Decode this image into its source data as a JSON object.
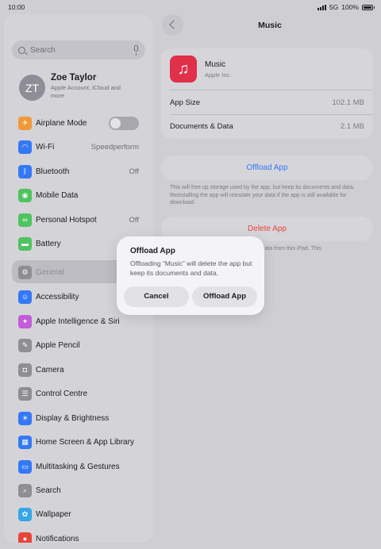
{
  "status": {
    "time": "10:00",
    "network": "5G",
    "battery": "100%"
  },
  "sidebar": {
    "search_placeholder": "Search",
    "profile": {
      "initials": "ZT",
      "name": "Zoe Taylor",
      "sub": "Apple Account, iCloud and more"
    },
    "items": [
      {
        "label": "Airplane Mode",
        "icon": "airplane-icon",
        "color": "#f09a37",
        "value": ""
      },
      {
        "label": "Wi-Fi",
        "icon": "wifi-icon",
        "color": "#3478f6",
        "value": "Speedperform"
      },
      {
        "label": "Bluetooth",
        "icon": "bluetooth-icon",
        "color": "#3478f6",
        "value": "Off"
      },
      {
        "label": "Mobile Data",
        "icon": "antenna-icon",
        "color": "#4fc35f",
        "value": ""
      },
      {
        "label": "Personal Hotspot",
        "icon": "hotspot-icon",
        "color": "#4fc35f",
        "value": "Off"
      },
      {
        "label": "Battery",
        "icon": "battery-icon",
        "color": "#4fc35f",
        "value": ""
      },
      {
        "label": "General",
        "icon": "gear-icon",
        "color": "#8e8e93",
        "value": ""
      },
      {
        "label": "Accessibility",
        "icon": "accessibility-icon",
        "color": "#3478f6",
        "value": ""
      },
      {
        "label": "Apple Intelligence & Siri",
        "icon": "siri-icon",
        "color": "#c25cd9",
        "value": ""
      },
      {
        "label": "Apple Pencil",
        "icon": "pencil-icon",
        "color": "#8e8e93",
        "value": ""
      },
      {
        "label": "Camera",
        "icon": "camera-icon",
        "color": "#8e8e93",
        "value": ""
      },
      {
        "label": "Control Centre",
        "icon": "sliders-icon",
        "color": "#8e8e93",
        "value": ""
      },
      {
        "label": "Display & Brightness",
        "icon": "sun-icon",
        "color": "#3478f6",
        "value": ""
      },
      {
        "label": "Home Screen & App Library",
        "icon": "home-screen-icon",
        "color": "#3478f6",
        "value": ""
      },
      {
        "label": "Multitasking & Gestures",
        "icon": "multitasking-icon",
        "color": "#3478f6",
        "value": ""
      },
      {
        "label": "Search",
        "icon": "search-icon",
        "color": "#8e8e93",
        "value": ""
      },
      {
        "label": "Wallpaper",
        "icon": "wallpaper-icon",
        "color": "#35a6e8",
        "value": ""
      },
      {
        "label": "Notifications",
        "icon": "notifications-icon",
        "color": "#e8443a",
        "value": ""
      }
    ]
  },
  "detail": {
    "title": "Music",
    "app_name": "Music",
    "app_vendor": "Apple Inc.",
    "app_size_label": "App Size",
    "app_size_value": "102.1 MB",
    "docs_label": "Documents & Data",
    "docs_value": "2.1 MB",
    "offload_button": "Offload App",
    "offload_note": "This will free up storage used by the app, but keep its documents and data. Reinstalling the app will reinstate your data if the app is still available for download.",
    "delete_button": "Delete App",
    "delete_note_visible": "ated data from this iPad. This"
  },
  "alert": {
    "title": "Offload App",
    "message": "Offloading “Music” will delete the app but keep its documents and data.",
    "cancel": "Cancel",
    "confirm": "Offload App"
  }
}
